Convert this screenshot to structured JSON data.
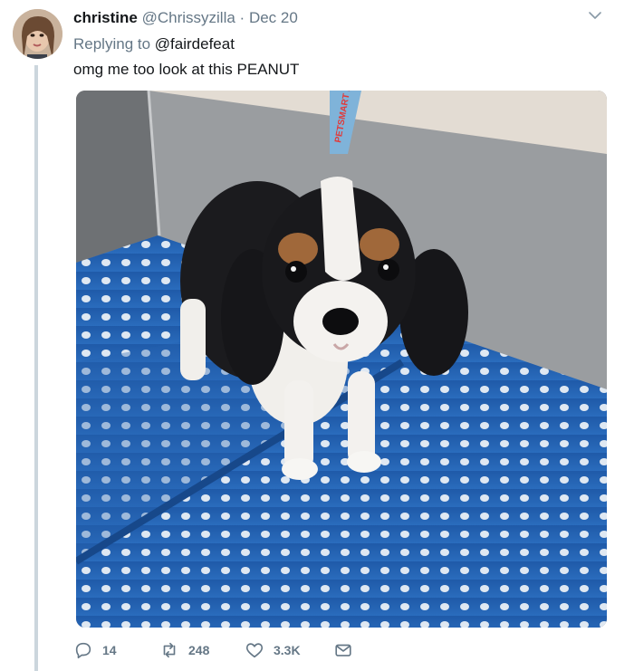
{
  "tweet": {
    "display_name": "christine",
    "handle": "@Chrissyzilla",
    "separator": "·",
    "date": "Dec 20",
    "replying_prefix": "Replying to",
    "replying_to": "@fairdefeat",
    "text": "omg me too look at this PEANUT",
    "photo_leash_text": "PETSMART PE"
  },
  "actions": {
    "reply_count": "14",
    "retweet_count": "248",
    "like_count": "3.3K"
  },
  "icons": {
    "avatar": "avatar",
    "caret": "chevron-down-icon",
    "reply": "reply-icon",
    "retweet": "retweet-icon",
    "like": "heart-icon",
    "dm": "envelope-icon"
  },
  "colors": {
    "secondary_text": "#657786",
    "primary_text": "#14171a",
    "thread_line": "#ccd6dd"
  }
}
